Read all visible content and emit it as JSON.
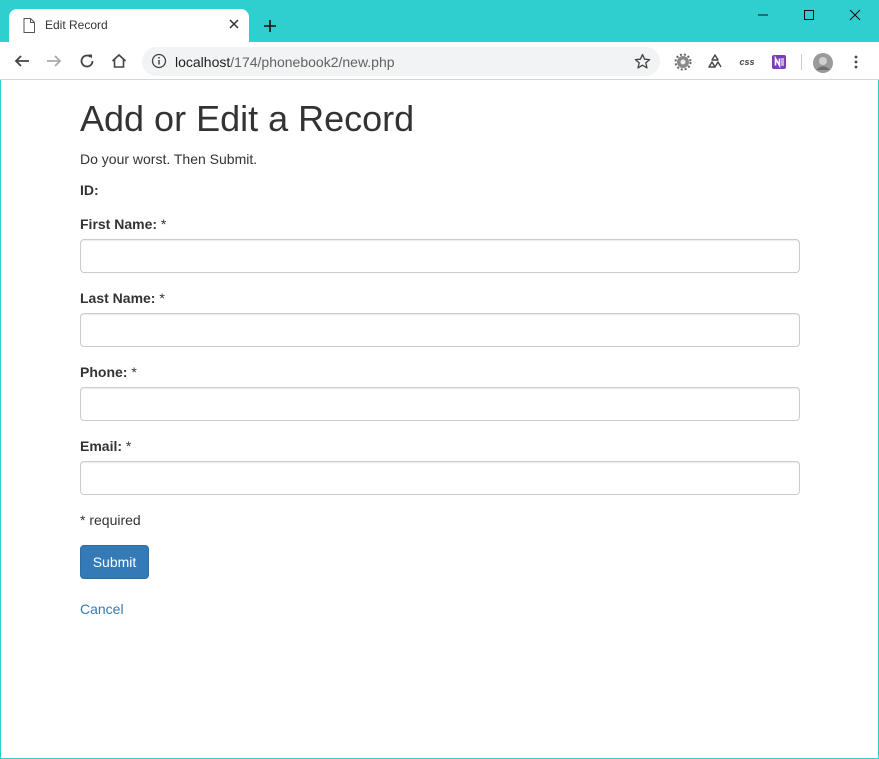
{
  "browser": {
    "tab_title": "Edit Record",
    "url_host": "localhost",
    "url_path": "/174/phonebook2/new.php",
    "extension_css_label": "css",
    "icons": [
      "page-icon",
      "close-icon",
      "plus-icon",
      "minimize-icon",
      "maximize-icon",
      "window-close-icon",
      "back-icon",
      "forward-icon",
      "reload-icon",
      "home-icon",
      "info-icon",
      "star-icon",
      "gear-extension-icon",
      "recycle-extension-icon",
      "onenote-icon",
      "avatar",
      "menu-icon"
    ],
    "colors": {
      "frame": "#2fcfcf",
      "primary": "#337ab7"
    }
  },
  "page": {
    "title": "Add or Edit a Record",
    "lead": "Do your worst. Then Submit.",
    "id_label": "ID:",
    "fields": [
      {
        "label": "First Name:",
        "marker": "*",
        "value": ""
      },
      {
        "label": "Last Name:",
        "marker": "*",
        "value": ""
      },
      {
        "label": "Phone:",
        "marker": "*",
        "value": ""
      },
      {
        "label": "Email:",
        "marker": "*",
        "value": ""
      }
    ],
    "required_note": "* required",
    "submit_label": "Submit",
    "cancel_label": "Cancel"
  }
}
